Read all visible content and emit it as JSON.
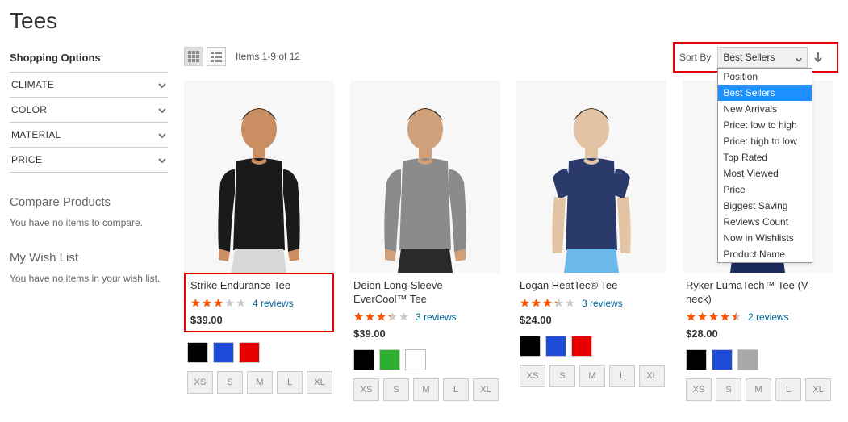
{
  "page": {
    "title": "Tees"
  },
  "sidebar": {
    "shopping_options_label": "Shopping Options",
    "filters": [
      "CLIMATE",
      "COLOR",
      "MATERIAL",
      "PRICE"
    ],
    "compare": {
      "heading": "Compare Products",
      "text": "You have no items to compare."
    },
    "wishlist": {
      "heading": "My Wish List",
      "text": "You have no items in your wish list."
    }
  },
  "toolbar": {
    "amount": "Items 1-9 of 12",
    "sort_label": "Sort By",
    "sort_selected": "Best Sellers",
    "sort_options": [
      "Position",
      "Best Sellers",
      "New Arrivals",
      "Price: low to high",
      "Price: high to low",
      "Top Rated",
      "Most Viewed",
      "Price",
      "Biggest Saving",
      "Reviews Count",
      "Now in Wishlists",
      "Product Name"
    ]
  },
  "sizes": [
    "XS",
    "S",
    "M",
    "L",
    "XL"
  ],
  "products": [
    {
      "name": "Strike Endurance Tee",
      "reviews_text": "4 reviews",
      "price": "$39.00",
      "rating": 3.0,
      "swatches": [
        "#000000",
        "#1e4bd8",
        "#e60000"
      ],
      "skin": "#c98f63",
      "shirt": "#1a1a1a",
      "pants": "#d8d8d8",
      "highlight": true
    },
    {
      "name": "Deion Long-Sleeve EverCool™ Tee",
      "reviews_text": "3 reviews",
      "price": "$39.00",
      "rating": 3.3,
      "swatches": [
        "#000000",
        "#2eae2e",
        "#ffffff"
      ],
      "skin": "#cfa07a",
      "shirt": "#8b8b8b",
      "pants": "#2a2a2a",
      "highlight": false
    },
    {
      "name": "Logan HeatTec® Tee",
      "reviews_text": "3 reviews",
      "price": "$24.00",
      "rating": 3.3,
      "swatches": [
        "#000000",
        "#1e4bd8",
        "#e60000"
      ],
      "skin": "#e2c3a3",
      "shirt": "#2a3a6a",
      "pants": "#6bb8ea",
      "highlight": false,
      "short": true
    },
    {
      "name": "Ryker LumaTech™ Tee (V-neck)",
      "reviews_text": "2 reviews",
      "price": "$28.00",
      "rating": 4.5,
      "swatches": [
        "#000000",
        "#1e4bd8",
        "#a8a8a8"
      ],
      "skin": "#dfb893",
      "shirt": "#efefef",
      "pants": "#1a2a5a",
      "highlight": false,
      "short": true
    }
  ]
}
